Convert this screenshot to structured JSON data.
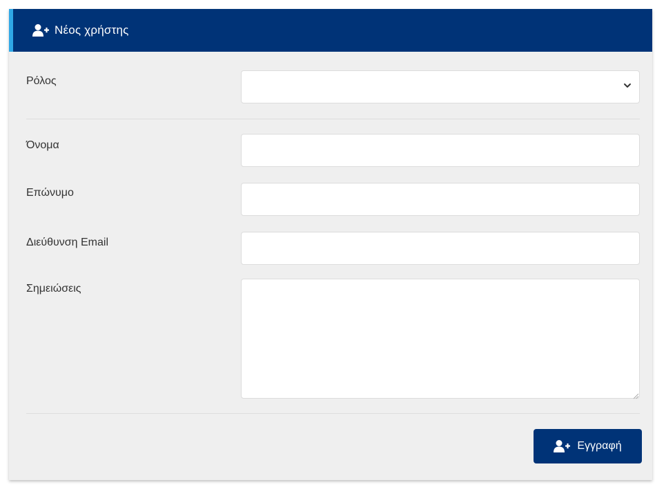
{
  "header": {
    "title": "Νέος χρήστης",
    "icon": "user-plus-icon",
    "color": "#003377",
    "accent_color": "#2fa8e6"
  },
  "form": {
    "role": {
      "label": "Ρόλος",
      "value": ""
    },
    "first_name": {
      "label": "Όνομα",
      "value": ""
    },
    "last_name": {
      "label": "Επώνυμο",
      "value": ""
    },
    "email": {
      "label": "Διεύθυνση Email",
      "value": ""
    },
    "notes": {
      "label": "Σημειώσεις",
      "value": ""
    }
  },
  "footer": {
    "submit_label": "Εγγραφή",
    "submit_icon": "user-plus-icon"
  }
}
